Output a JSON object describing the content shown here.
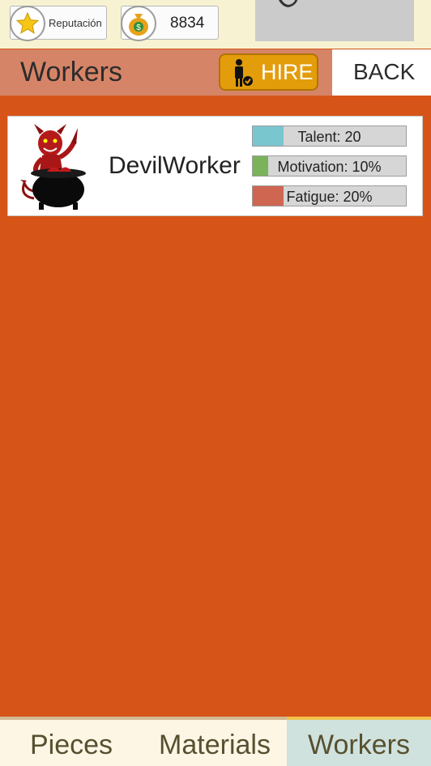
{
  "topbar": {
    "reputation_label": "Reputación",
    "money_value": "8834",
    "corner_text": "O"
  },
  "header": {
    "title": "Workers",
    "hire_label": "HIRE",
    "back_label": "BACK"
  },
  "workers": [
    {
      "name": "DevilWorker",
      "stats": [
        {
          "label": "Talent: 20",
          "fraction": 0.2,
          "color": "#7ac6cf"
        },
        {
          "label": "Motivation: 10%",
          "fraction": 0.1,
          "color": "#7bb35a"
        },
        {
          "label": "Fatigue: 20%",
          "fraction": 0.2,
          "color": "#cf6652"
        }
      ]
    }
  ],
  "tabs": [
    {
      "label": "Pieces",
      "active": false
    },
    {
      "label": "Materials",
      "active": false
    },
    {
      "label": "Workers",
      "active": true
    }
  ],
  "colors": {
    "background": "#d65418",
    "header": "#d68467",
    "hire_button": "#e39d0b",
    "active_tab": "#cfe2dd"
  }
}
